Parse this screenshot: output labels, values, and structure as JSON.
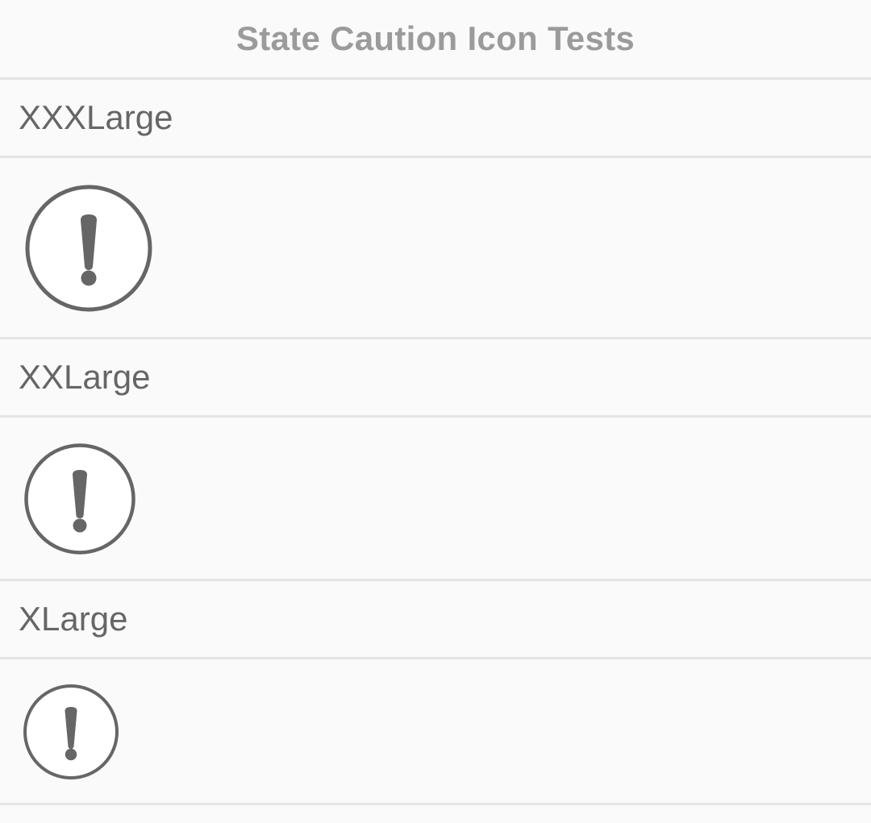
{
  "header": {
    "title": "State Caution Icon Tests"
  },
  "sections": [
    {
      "label": "XXXLarge",
      "icon": "caution-icon"
    },
    {
      "label": "XXLarge",
      "icon": "caution-icon"
    },
    {
      "label": "XLarge",
      "icon": "caution-icon"
    }
  ],
  "colors": {
    "background": "#fafafa",
    "divider": "#e4e4e4",
    "title_text": "#9b9b9b",
    "label_text": "#666666",
    "icon_stroke": "#666666",
    "icon_fill": "#ffffff"
  }
}
